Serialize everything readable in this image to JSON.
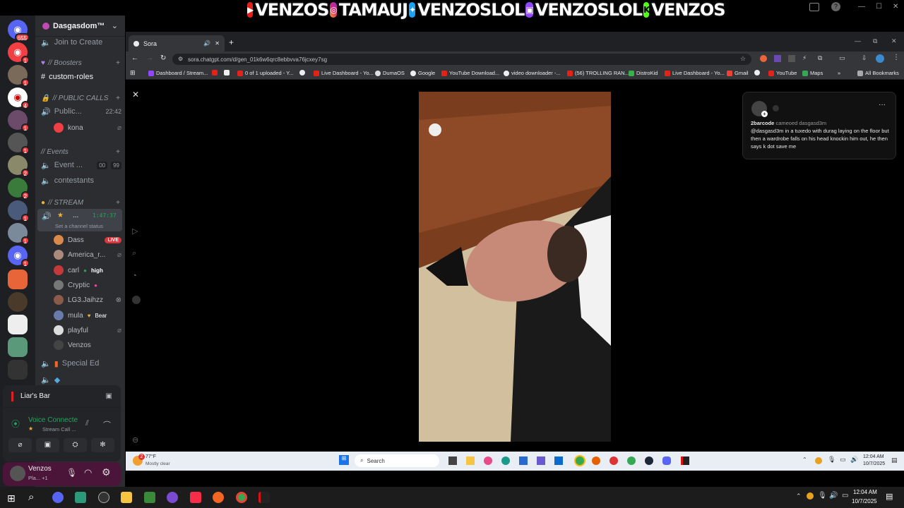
{
  "banner": {
    "text": "VENZOSTAMAUJVENZOSLOLVENZOSLOLVENZOS",
    "segments": [
      "VENZOS",
      "TAMAUJ",
      "VENZOSLOL",
      "VENZOSLOL",
      "VENZOS"
    ]
  },
  "rail": {
    "top_badge": "655",
    "badges": [
      "1",
      "1",
      "4",
      "1",
      "1",
      "2",
      "2",
      "1",
      "1",
      "1",
      "1",
      "3",
      "2"
    ]
  },
  "server": {
    "name": "Dasgasdom™"
  },
  "channels": {
    "join": "Join to Create",
    "boosters_cat": "// Boosters",
    "custom_roles": "custom-roles",
    "public_calls_cat": "// PUBLIC CALLS",
    "public_channel": "Public...",
    "public_time": "22:42",
    "kona": "kona",
    "events_cat": "// Events",
    "event_channel": "Event ...",
    "event_counts": [
      "00",
      "99"
    ],
    "contestants": "contestants",
    "stream_cat": "// STREAM",
    "stream_channel": "...",
    "stream_time": "1:47:37",
    "stream_status": "Set a channel status",
    "members": [
      "Dass",
      "America_r...",
      "carl",
      "Cryptic",
      "LG3.Jaihzz",
      "mula",
      "playful",
      "Venzos"
    ],
    "live_badge": "LIVE",
    "carl_status": "high",
    "mula_status": "Bear",
    "special_ed": "Special Ed"
  },
  "voice": {
    "activity": "Liar's Bar",
    "status": "Voice Connecte",
    "sub": "Stream Call ..."
  },
  "user": {
    "name": "Venzos",
    "status": "Pla... +1"
  },
  "browser": {
    "tab_title": "Sora",
    "url": "sora.chatgpt.com/d/gen_01k6w6qrc8ebbvva76jcxey7sg",
    "bookmarks": [
      "Dashboard / Stream...",
      "0 of 1 uploaded - Y...",
      "Live Dashboard - Yo...",
      "DumaOS",
      "Google",
      "YouTube Download...",
      "video downloader -...",
      "(56) TROLLING RAN...",
      "DistroKid",
      "Live Dashboard - Yo...",
      "Gmail",
      "YouTube",
      "Maps",
      "All Bookmarks"
    ]
  },
  "post": {
    "author": "2barcode",
    "action": "cameoed dasgasd3m",
    "text": "@dasgasd3m in a tuxedo with durag laying on the floor but then a wardrobe falls on his head knockin him out, he then says k dot save me"
  },
  "inner_taskbar": {
    "temp": "77°F",
    "weather": "Mostly clear",
    "search": "Search",
    "time": "12:04 AM",
    "date": "10/7/2025",
    "badge": "2"
  },
  "taskbar": {
    "time": "12:04 AM",
    "date": "10/7/2025"
  },
  "colors": {
    "discord_bg": "#2b2d31",
    "rail_bg": "#1e1f22",
    "browser_bar": "#35363a",
    "user_panel": "#4a1538",
    "live_red": "#da373c",
    "voice_green": "#23a55a"
  }
}
